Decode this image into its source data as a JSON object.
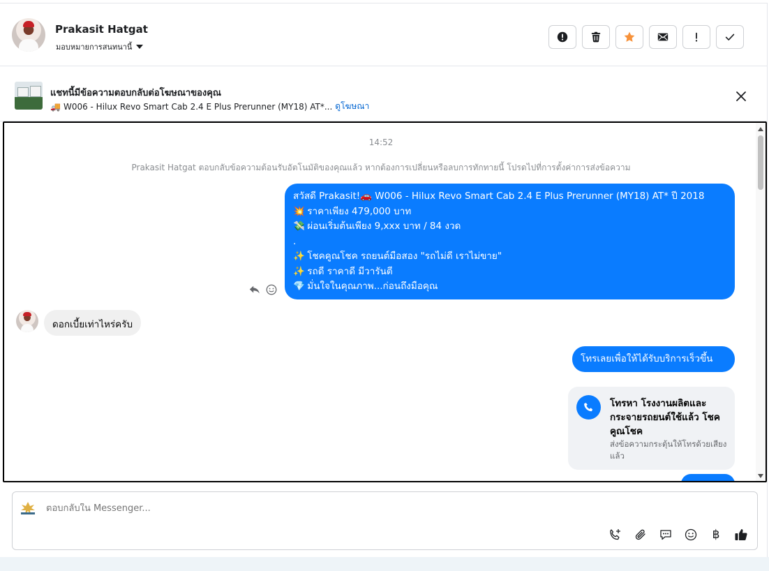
{
  "header": {
    "contact_name": "Prakasit Hatgat",
    "assign_label": "มอบหมายการสนทนานี้",
    "actions": [
      {
        "name": "report-button",
        "icon": "alert-circle-icon"
      },
      {
        "name": "delete-button",
        "icon": "trash-icon"
      },
      {
        "name": "star-button",
        "icon": "star-icon"
      },
      {
        "name": "mark-unread-button",
        "icon": "envelope-icon"
      },
      {
        "name": "important-button",
        "icon": "exclamation-icon"
      },
      {
        "name": "done-button",
        "icon": "checkmark-icon"
      }
    ]
  },
  "ad": {
    "title": "แชทนี้มีข้อความตอบกลับต่อโฆษณาของคุณ",
    "subtitle": "W006 - Hilux Revo Smart Cab 2.4 E Plus Prerunner (MY18) AT*...",
    "link": "ดูโฆษณา"
  },
  "chat": {
    "time": "14:52",
    "system_note": "Prakasit Hatgat ตอบกลับข้อความต้อนรับอัตโนมัติของคุณแล้ว หากต้องการเปลี่ยนหรือลบการทักทายนี้ โปรดไปที่การตั้งค่าการส่งข้อความ",
    "welcome_lines": [
      {
        "emoji": "",
        "text": "สวัสดี Prakasit!🚗 W006 -  Hilux Revo Smart Cab 2.4 E Plus Prerunner (MY18) AT*  ปี 2018"
      },
      {
        "emoji": "💥",
        "text": "ราคาเพียง 479,000 บาท"
      },
      {
        "emoji": "💸",
        "text": "ผ่อนเริ่มต้นเพียง 9,xxx บาท / 84 งวด"
      },
      {
        "emoji": "",
        "text": "."
      },
      {
        "emoji": "✨",
        "text": "โชคคูณโชค รถยนต์มือสอง \"รถไม่ดี เราไม่ขาย\""
      },
      {
        "emoji": "✨",
        "text": "รถดี ราคาดี มีวารันตี"
      },
      {
        "emoji": "💎",
        "text": "มั่นใจในคุณภาพ...ก่อนถึงมือคุณ"
      }
    ],
    "incoming_message": "ดอกเบี้ยเท่าไหร่ครับ",
    "outgoing_message_2": "โทรเลยเพื่อให้ได้รับบริการเร็วขึ้น",
    "call_card": {
      "title": "โทรหา โรงงานผลิตและกระจายรถยนต์ใช้แล้ว โชคคูณโชค",
      "description": "ส่งข้อความกระตุ้นให้โทรด้วยเสียงแล้ว"
    }
  },
  "composer": {
    "placeholder": "ตอบกลับใน Messenger...",
    "tools": [
      "phone-plus-icon",
      "paperclip-icon",
      "saved-reply-icon",
      "emoji-icon",
      "baht-icon",
      "thumbs-up-icon"
    ],
    "baht_symbol": "฿"
  },
  "colors": {
    "accent": "#0a7cff",
    "star": "#f7923a",
    "incoming_bubble": "#f0f0f0"
  }
}
